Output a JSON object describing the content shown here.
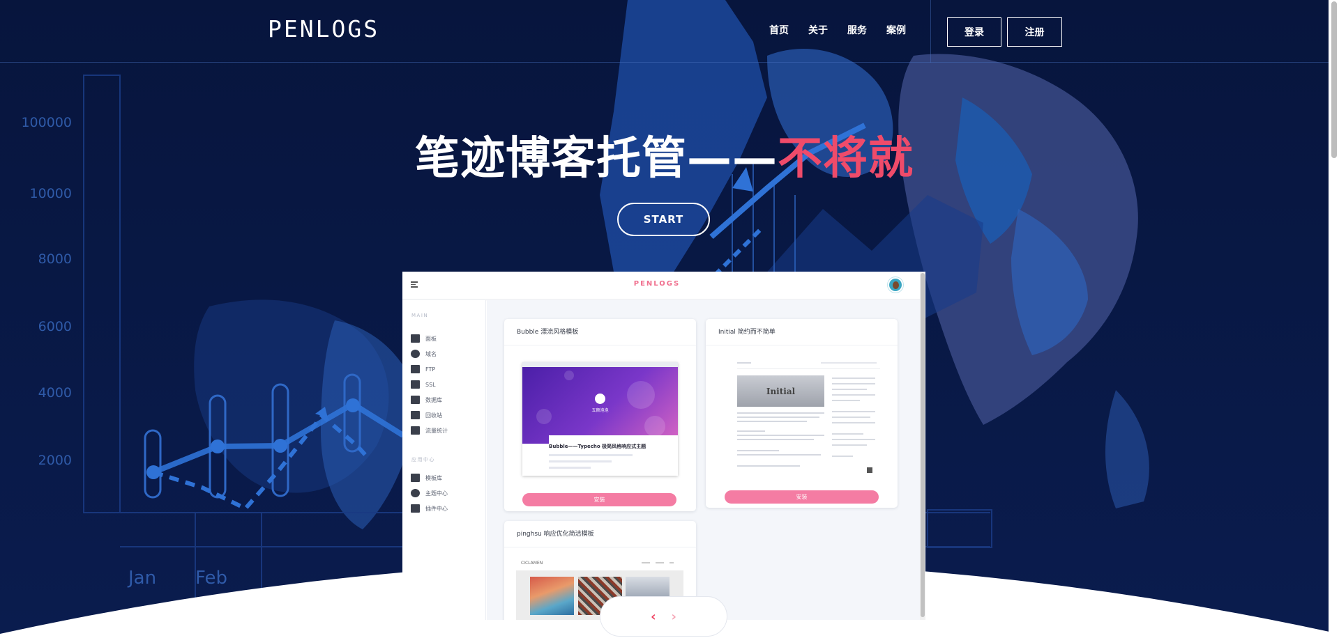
{
  "header": {
    "logo": "PENLOGS",
    "nav": [
      "首页",
      "关于",
      "服务",
      "案例"
    ],
    "login_label": "登录",
    "register_label": "注册"
  },
  "hero": {
    "title_main": "笔迹博客托管——",
    "title_accent": "不将就",
    "start_label": "START"
  },
  "background_chart": {
    "y_ticks": [
      "100000",
      "10000",
      "8000",
      "6000",
      "4000",
      "2000"
    ],
    "x_ticks": [
      "Jan",
      "Feb"
    ]
  },
  "preview": {
    "logo": "PENLOGS",
    "sidebar": {
      "main_heading": "MAIN",
      "main_items": [
        {
          "label": "面板",
          "icon": "home-icon"
        },
        {
          "label": "域名",
          "icon": "globe-icon"
        },
        {
          "label": "FTP",
          "icon": "folder-icon"
        },
        {
          "label": "SSL",
          "icon": "lock-icon"
        },
        {
          "label": "数据库",
          "icon": "server-icon"
        },
        {
          "label": "回收站",
          "icon": "trash-icon"
        },
        {
          "label": "流量统计",
          "icon": "bar-chart-icon"
        }
      ],
      "extra_heading": "应用中心",
      "extra_items": [
        {
          "label": "模板库",
          "icon": "grid-icon"
        },
        {
          "label": "主题中心",
          "icon": "palette-icon"
        },
        {
          "label": "插件中心",
          "icon": "briefcase-icon"
        }
      ]
    },
    "cards": [
      {
        "title": "Bubble 漂流风格模板",
        "install_label": "安装",
        "thumb_site": "五颜泡泡",
        "thumb_post": "Bubble——Typecho 极简风格响应式主题"
      },
      {
        "title": "Initial 简约而不简单",
        "install_label": "安装",
        "thumb_banner": "Initial"
      },
      {
        "title": "pinghsu 响应优化简洁模板",
        "thumb_logo": "CICLAMEN"
      }
    ]
  },
  "pager": {
    "prev": "‹",
    "next": "›"
  },
  "colors": {
    "background": "#06133a",
    "accent_red": "#ef4b6a",
    "install_pink": "#f47ca3",
    "preview_logo": "#f06f8e"
  }
}
